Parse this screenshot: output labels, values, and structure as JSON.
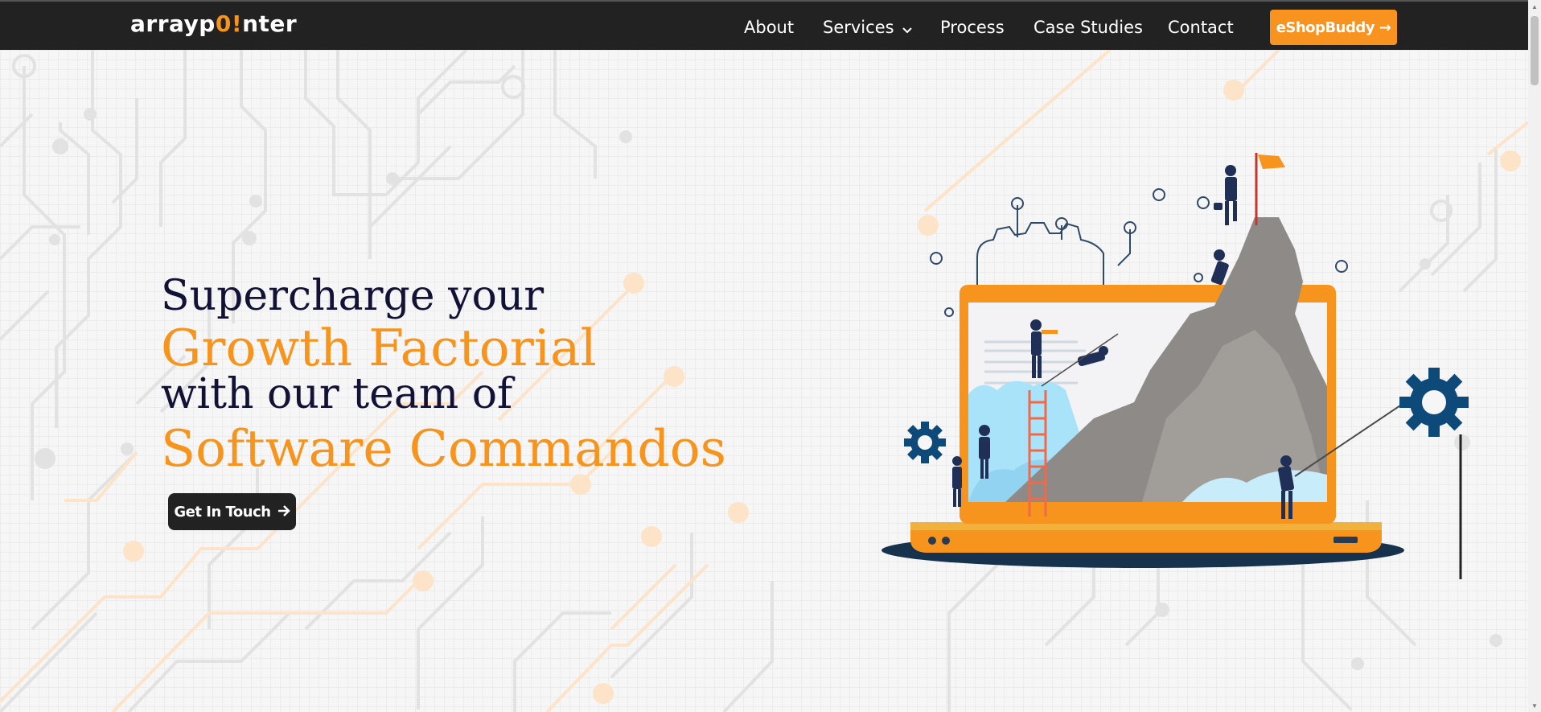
{
  "logo": {
    "prefix": "arrayp",
    "accent": "0",
    "excl": "!",
    "suffix": "nter"
  },
  "nav": {
    "about": "About",
    "services": "Services",
    "process": "Process",
    "case_studies": "Case Studies",
    "contact": "Contact",
    "cta": "eShopBuddy →"
  },
  "hero": {
    "line1": "Supercharge your",
    "line2": "Growth Factorial",
    "line3": "with our team of",
    "line4": "Software Commandos",
    "button": "Get In Touch"
  },
  "colors": {
    "accent": "#f7941d",
    "dark_text": "#121236",
    "navbar": "#222222"
  }
}
